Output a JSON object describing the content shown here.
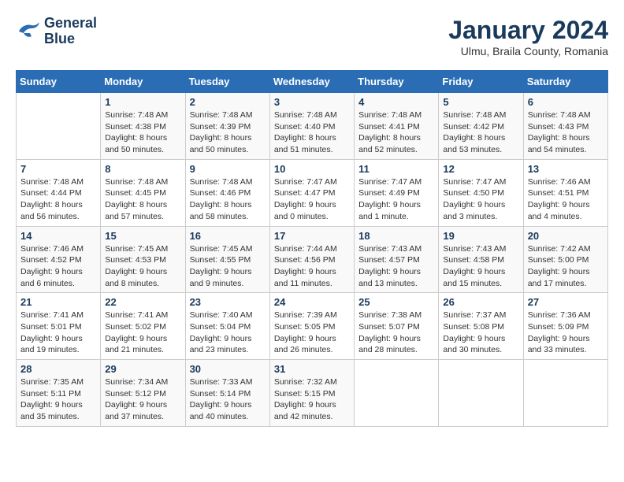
{
  "header": {
    "logo_line1": "General",
    "logo_line2": "Blue",
    "month_title": "January 2024",
    "subtitle": "Ulmu, Braila County, Romania"
  },
  "days_of_week": [
    "Sunday",
    "Monday",
    "Tuesday",
    "Wednesday",
    "Thursday",
    "Friday",
    "Saturday"
  ],
  "weeks": [
    [
      {
        "day": "",
        "info": ""
      },
      {
        "day": "1",
        "info": "Sunrise: 7:48 AM\nSunset: 4:38 PM\nDaylight: 8 hours\nand 50 minutes."
      },
      {
        "day": "2",
        "info": "Sunrise: 7:48 AM\nSunset: 4:39 PM\nDaylight: 8 hours\nand 50 minutes."
      },
      {
        "day": "3",
        "info": "Sunrise: 7:48 AM\nSunset: 4:40 PM\nDaylight: 8 hours\nand 51 minutes."
      },
      {
        "day": "4",
        "info": "Sunrise: 7:48 AM\nSunset: 4:41 PM\nDaylight: 8 hours\nand 52 minutes."
      },
      {
        "day": "5",
        "info": "Sunrise: 7:48 AM\nSunset: 4:42 PM\nDaylight: 8 hours\nand 53 minutes."
      },
      {
        "day": "6",
        "info": "Sunrise: 7:48 AM\nSunset: 4:43 PM\nDaylight: 8 hours\nand 54 minutes."
      }
    ],
    [
      {
        "day": "7",
        "info": "Sunrise: 7:48 AM\nSunset: 4:44 PM\nDaylight: 8 hours\nand 56 minutes."
      },
      {
        "day": "8",
        "info": "Sunrise: 7:48 AM\nSunset: 4:45 PM\nDaylight: 8 hours\nand 57 minutes."
      },
      {
        "day": "9",
        "info": "Sunrise: 7:48 AM\nSunset: 4:46 PM\nDaylight: 8 hours\nand 58 minutes."
      },
      {
        "day": "10",
        "info": "Sunrise: 7:47 AM\nSunset: 4:47 PM\nDaylight: 9 hours\nand 0 minutes."
      },
      {
        "day": "11",
        "info": "Sunrise: 7:47 AM\nSunset: 4:49 PM\nDaylight: 9 hours\nand 1 minute."
      },
      {
        "day": "12",
        "info": "Sunrise: 7:47 AM\nSunset: 4:50 PM\nDaylight: 9 hours\nand 3 minutes."
      },
      {
        "day": "13",
        "info": "Sunrise: 7:46 AM\nSunset: 4:51 PM\nDaylight: 9 hours\nand 4 minutes."
      }
    ],
    [
      {
        "day": "14",
        "info": "Sunrise: 7:46 AM\nSunset: 4:52 PM\nDaylight: 9 hours\nand 6 minutes."
      },
      {
        "day": "15",
        "info": "Sunrise: 7:45 AM\nSunset: 4:53 PM\nDaylight: 9 hours\nand 8 minutes."
      },
      {
        "day": "16",
        "info": "Sunrise: 7:45 AM\nSunset: 4:55 PM\nDaylight: 9 hours\nand 9 minutes."
      },
      {
        "day": "17",
        "info": "Sunrise: 7:44 AM\nSunset: 4:56 PM\nDaylight: 9 hours\nand 11 minutes."
      },
      {
        "day": "18",
        "info": "Sunrise: 7:43 AM\nSunset: 4:57 PM\nDaylight: 9 hours\nand 13 minutes."
      },
      {
        "day": "19",
        "info": "Sunrise: 7:43 AM\nSunset: 4:58 PM\nDaylight: 9 hours\nand 15 minutes."
      },
      {
        "day": "20",
        "info": "Sunrise: 7:42 AM\nSunset: 5:00 PM\nDaylight: 9 hours\nand 17 minutes."
      }
    ],
    [
      {
        "day": "21",
        "info": "Sunrise: 7:41 AM\nSunset: 5:01 PM\nDaylight: 9 hours\nand 19 minutes."
      },
      {
        "day": "22",
        "info": "Sunrise: 7:41 AM\nSunset: 5:02 PM\nDaylight: 9 hours\nand 21 minutes."
      },
      {
        "day": "23",
        "info": "Sunrise: 7:40 AM\nSunset: 5:04 PM\nDaylight: 9 hours\nand 23 minutes."
      },
      {
        "day": "24",
        "info": "Sunrise: 7:39 AM\nSunset: 5:05 PM\nDaylight: 9 hours\nand 26 minutes."
      },
      {
        "day": "25",
        "info": "Sunrise: 7:38 AM\nSunset: 5:07 PM\nDaylight: 9 hours\nand 28 minutes."
      },
      {
        "day": "26",
        "info": "Sunrise: 7:37 AM\nSunset: 5:08 PM\nDaylight: 9 hours\nand 30 minutes."
      },
      {
        "day": "27",
        "info": "Sunrise: 7:36 AM\nSunset: 5:09 PM\nDaylight: 9 hours\nand 33 minutes."
      }
    ],
    [
      {
        "day": "28",
        "info": "Sunrise: 7:35 AM\nSunset: 5:11 PM\nDaylight: 9 hours\nand 35 minutes."
      },
      {
        "day": "29",
        "info": "Sunrise: 7:34 AM\nSunset: 5:12 PM\nDaylight: 9 hours\nand 37 minutes."
      },
      {
        "day": "30",
        "info": "Sunrise: 7:33 AM\nSunset: 5:14 PM\nDaylight: 9 hours\nand 40 minutes."
      },
      {
        "day": "31",
        "info": "Sunrise: 7:32 AM\nSunset: 5:15 PM\nDaylight: 9 hours\nand 42 minutes."
      },
      {
        "day": "",
        "info": ""
      },
      {
        "day": "",
        "info": ""
      },
      {
        "day": "",
        "info": ""
      }
    ]
  ]
}
